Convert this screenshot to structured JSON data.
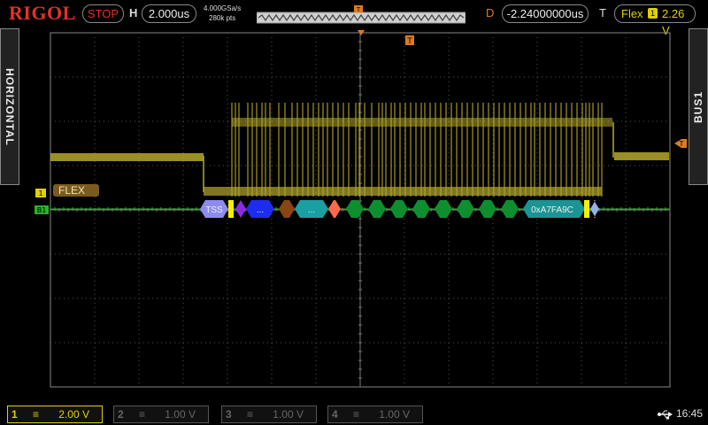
{
  "brand": "RIGOL",
  "run_state": "STOP",
  "horizontal": {
    "label": "H",
    "timebase": "2.000us",
    "sample_rate": "4.000GSa/s",
    "memory_depth": "280k pts"
  },
  "delay": {
    "label": "D",
    "value": "-2.24000000us"
  },
  "trigger": {
    "label": "T",
    "source": "Flex",
    "channel": "1",
    "level": "2.26 V"
  },
  "side_left": "HORIZONTAL",
  "side_right": "BUS1",
  "markers": {
    "trigger_top": "T",
    "ch1": "1",
    "bus1": "B1"
  },
  "bus_label": "FLEX",
  "decode": {
    "tss_label": "TSS",
    "ellipsis": "...",
    "crc": "0xA7FA9C"
  },
  "channels": [
    {
      "num": "1",
      "coupling": "≡",
      "scale": "2.00 V",
      "active": true
    },
    {
      "num": "2",
      "coupling": "≡",
      "scale": "1.00 V",
      "active": false
    },
    {
      "num": "3",
      "coupling": "≡",
      "scale": "1.00 V",
      "active": false
    },
    {
      "num": "4",
      "coupling": "≡",
      "scale": "1.00 V",
      "active": false
    }
  ],
  "status": {
    "usb_icon": "usb-icon",
    "time": "16:45"
  },
  "colors": {
    "ch1": "#b5a82c",
    "bus": "#2fae2f",
    "grid": "#555555",
    "stop": "#e63027"
  }
}
